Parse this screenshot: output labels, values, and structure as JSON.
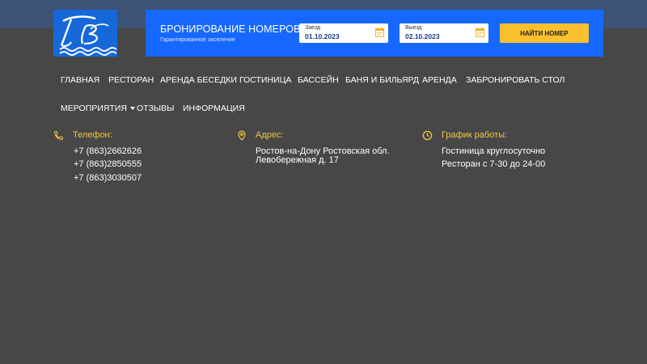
{
  "colors": {
    "background": "#474747",
    "top_band": "#3c5376",
    "booking_panel": "#1668ff",
    "accent": "#fbc02d",
    "info_heading": "#f5c542"
  },
  "logo": {
    "icon": "hotel-logo-monogram"
  },
  "booking": {
    "title": "БРОНИРОВАНИЕ НОМЕРОВ",
    "subtitle": "Гарантированное заселение",
    "checkin": {
      "label": "Заезд",
      "value": "01.10.2023",
      "icon": "calendar-icon"
    },
    "checkout": {
      "label": "Выезд",
      "value": "02.10.2023",
      "icon": "calendar-icon"
    },
    "submit_label": "НАЙТИ НОМЕР"
  },
  "nav": {
    "row1": [
      "ГЛАВНАЯ",
      "РЕСТОРАН",
      "АРЕНДА БЕСЕДКИ",
      "ГОСТИНИЦА",
      "БАССЕЙН",
      "БАНЯ И БИЛЬЯРД",
      "АРЕНДА",
      "ЗАБРОНИРОВАТЬ СТОЛ"
    ],
    "row2": [
      "МЕРОПРИЯТИЯ",
      "ОТЗЫВЫ",
      "ИНФОРМАЦИЯ"
    ]
  },
  "contacts": {
    "phone": {
      "icon": "phone-icon",
      "heading": "Телефон:",
      "lines": [
        "+7 (863)2662626",
        "+7 (863)2850555",
        "+7 (863)3030507"
      ]
    },
    "address": {
      "icon": "location-pin-icon",
      "heading": "Адрес:",
      "lines": [
        "Ростов-на-Дону Ростовская обл.",
        "Левобережная д. 17"
      ]
    },
    "hours": {
      "icon": "clock-icon",
      "heading": "График работы:",
      "lines": [
        "Гостиница круглосуточно",
        "Ресторан с 7-30 до 24-00"
      ]
    }
  }
}
